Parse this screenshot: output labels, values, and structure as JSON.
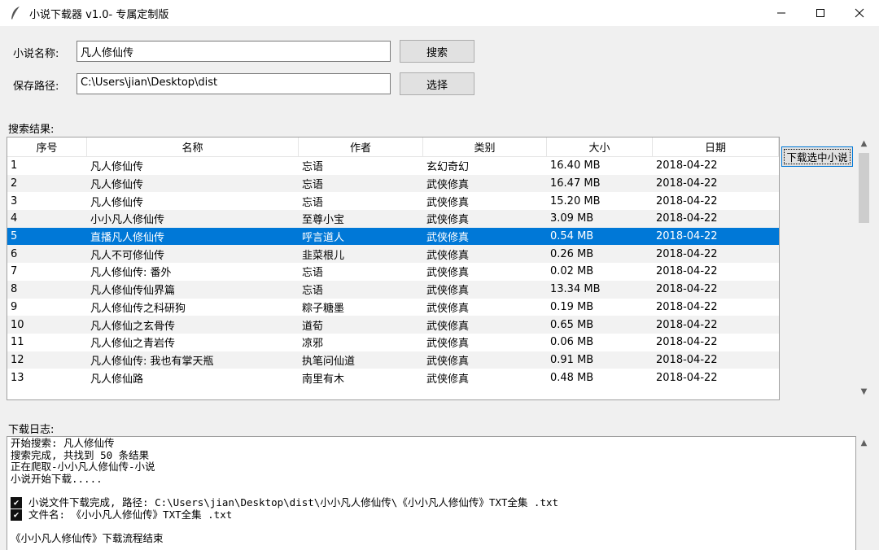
{
  "window": {
    "title": "小说下载器 v1.0- 专属定制版",
    "icon": "feather-icon"
  },
  "form": {
    "name_label": "小说名称:",
    "name_value": "凡人修仙传",
    "search_button": "搜索",
    "path_label": "保存路径:",
    "path_value": "C:\\Users\\jian\\Desktop\\dist",
    "choose_button": "选择"
  },
  "results": {
    "label": "搜索结果:",
    "download_button": "下载选中小说",
    "columns": [
      "序号",
      "名称",
      "作者",
      "类别",
      "大小",
      "日期"
    ],
    "selected_index": 4,
    "rows": [
      [
        "1",
        "凡人修仙传",
        "忘语",
        "玄幻奇幻",
        "16.40 MB",
        "2018-04-22"
      ],
      [
        "2",
        "凡人修仙传",
        "忘语",
        "武侠修真",
        "16.47 MB",
        "2018-04-22"
      ],
      [
        "3",
        "凡人修仙传",
        "忘语",
        "武侠修真",
        "15.20 MB",
        "2018-04-22"
      ],
      [
        "4",
        "小小凡人修仙传",
        "至尊小宝",
        "武侠修真",
        "3.09 MB",
        "2018-04-22"
      ],
      [
        "5",
        "直播凡人修仙传",
        "呼言道人",
        "武侠修真",
        "0.54 MB",
        "2018-04-22"
      ],
      [
        "6",
        "凡人不可修仙传",
        "韭菜根儿",
        "武侠修真",
        "0.26 MB",
        "2018-04-22"
      ],
      [
        "7",
        "凡人修仙传: 番外",
        "忘语",
        "武侠修真",
        "0.02 MB",
        "2018-04-22"
      ],
      [
        "8",
        "凡人修仙传仙界篇",
        "忘语",
        "武侠修真",
        "13.34 MB",
        "2018-04-22"
      ],
      [
        "9",
        "凡人修仙传之科研狗",
        "粽子糖墨",
        "武侠修真",
        "0.19 MB",
        "2018-04-22"
      ],
      [
        "10",
        "凡人修仙之玄骨传",
        "道荀",
        "武侠修真",
        "0.65 MB",
        "2018-04-22"
      ],
      [
        "11",
        "凡人修仙之青岩传",
        "凉邪",
        "武侠修真",
        "0.06 MB",
        "2018-04-22"
      ],
      [
        "12",
        "凡人修仙传: 我也有掌天瓶",
        "执笔问仙道",
        "武侠修真",
        "0.91 MB",
        "2018-04-22"
      ],
      [
        "13",
        "凡人修仙路",
        "南里有木",
        "武侠修真",
        "0.48 MB",
        "2018-04-22"
      ]
    ]
  },
  "log": {
    "label": "下载日志:",
    "lines": [
      {
        "text": "开始搜索: 凡人修仙传",
        "check": false
      },
      {
        "text": "搜索完成, 共找到 50 条结果",
        "check": false
      },
      {
        "text": "正在爬取-小小凡人修仙传-小说",
        "check": false
      },
      {
        "text": "小说开始下载.....",
        "check": false
      },
      {
        "text": "",
        "check": false
      },
      {
        "text": "小说文件下载完成, 路径: C:\\Users\\jian\\Desktop\\dist\\小小凡人修仙传\\《小小凡人修仙传》TXT全集 .txt",
        "check": true
      },
      {
        "text": "文件名: 《小小凡人修仙传》TXT全集 .txt",
        "check": true
      },
      {
        "text": "",
        "check": false
      },
      {
        "text": "《小小凡人修仙传》下载流程结束",
        "check": false
      }
    ]
  }
}
